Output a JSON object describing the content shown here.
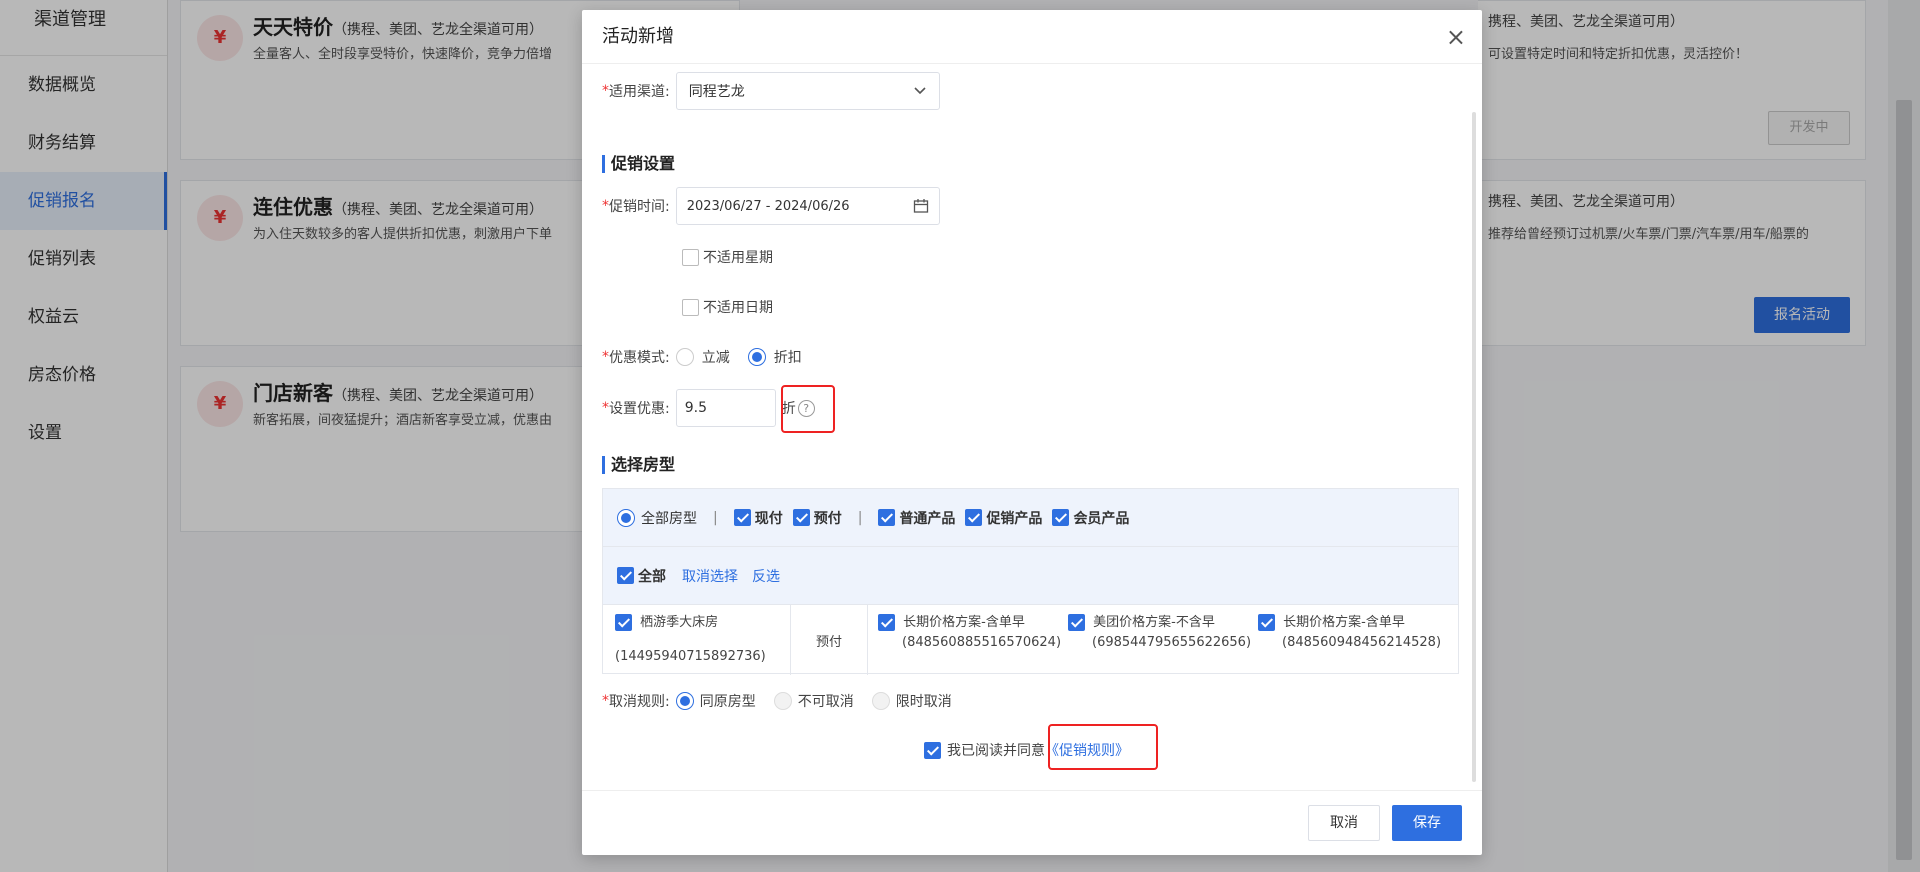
{
  "sidebar": {
    "header": "渠道管理",
    "items": [
      {
        "label": "数据概览"
      },
      {
        "label": "财务结算"
      },
      {
        "label": "促销报名"
      },
      {
        "label": "促销列表"
      },
      {
        "label": "权益云"
      },
      {
        "label": "房态价格"
      },
      {
        "label": "设置"
      }
    ]
  },
  "cards": [
    {
      "badge": "¥",
      "title": "天天特价",
      "sub": "（携程、美团、艺龙全渠道可用）",
      "desc": "全量客人、全时段享受特价，快速降价，竞争力倍增"
    },
    {
      "badge": "¥",
      "title": "连住优惠",
      "sub": "（携程、美团、艺龙全渠道可用）",
      "desc": "为入住天数较多的客人提供折扣优惠，刺激用户下单"
    },
    {
      "badge": "¥",
      "title": "门店新客",
      "sub": "（携程、美团、艺龙全渠道可用）",
      "desc": "新客拓展，间夜猛提升；酒店新客享受立减，优惠由"
    }
  ],
  "right_cards": [
    {
      "title": "携程、美团、艺龙全渠道可用）",
      "desc": "可设置特定时间和特定折扣优惠，灵活控价！",
      "button": "开发中"
    },
    {
      "title": "携程、美团、艺龙全渠道可用）",
      "desc": "推荐给曾经预订过机票/火车票/门票/汽车票/用车/船票的",
      "button": "报名活动"
    }
  ],
  "modal": {
    "title": "活动新增",
    "close_icon": "×",
    "channel_label": "适用渠道:",
    "channel_value": "同程艺龙",
    "section_promo": "促销设置",
    "time_label": "促销时间:",
    "time_value": "2023/06/27 - 2024/06/26",
    "no_weekday": "不适用星期",
    "no_date": "不适用日期",
    "mode_label": "优惠模式:",
    "mode_options": [
      "立减",
      "折扣"
    ],
    "discount_label": "设置优惠:",
    "discount_value": "9.5",
    "discount_unit": "折",
    "help_icon": "?",
    "section_room": "选择房型",
    "room_all_types": "全部房型",
    "pay_now": "现付",
    "pay_pre": "预付",
    "product_normal": "普通产品",
    "product_promo": "促销产品",
    "product_member": "会员产品",
    "select_all": "全部",
    "deselect": "取消选择",
    "invert": "反选",
    "room_name": "栖游季大床房",
    "room_id": "(14495940715892736)",
    "room_pay": "预付",
    "plans": [
      {
        "name": "长期价格方案-含单早",
        "id": "(848560885516570624)"
      },
      {
        "name": "美团价格方案-不含早",
        "id": "(698544795655622656)"
      },
      {
        "name": "长期价格方案-含单早",
        "id": "(848560948456214528)"
      }
    ],
    "cancel_label": "取消规则:",
    "cancel_options": [
      "同原房型",
      "不可取消",
      "限时取消"
    ],
    "agree_text": "我已阅读并同意",
    "agree_link": "《促销规则》",
    "btn_cancel": "取消",
    "btn_save": "保存"
  },
  "colors": {
    "accent": "#2e6fe0",
    "required": "#e33",
    "highlight_box": "#e22"
  }
}
